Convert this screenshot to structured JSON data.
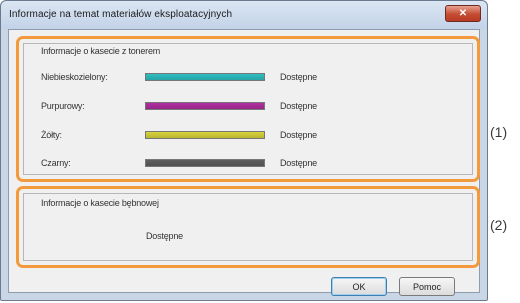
{
  "window": {
    "title": "Informacje na temat materiałów eksploatacyjnych",
    "close_glyph": "✕"
  },
  "toner_group": {
    "title": "Informacje o kasecie z tonerem",
    "rows": [
      {
        "label": "Niebieskozielony:",
        "status": "Dostępne",
        "color": "#2fbfc3",
        "level": 1.0
      },
      {
        "label": "Purpurowy:",
        "status": "Dostępne",
        "color": "#b12ea0",
        "level": 1.0
      },
      {
        "label": "Żółty:",
        "status": "Dostępne",
        "color": "#d9d43a",
        "level": 1.0
      },
      {
        "label": "Czarny:",
        "status": "Dostępne",
        "color": "#5f5f5f",
        "level": 1.0
      }
    ]
  },
  "drum_group": {
    "title": "Informacje o kasecie bębnowej",
    "status": "Dostępne"
  },
  "callouts": {
    "c1": "(1)",
    "c2": "(2)"
  },
  "buttons": {
    "ok": "OK",
    "help": "Pomoc"
  },
  "colors": {
    "highlight": "#f39a3d"
  }
}
